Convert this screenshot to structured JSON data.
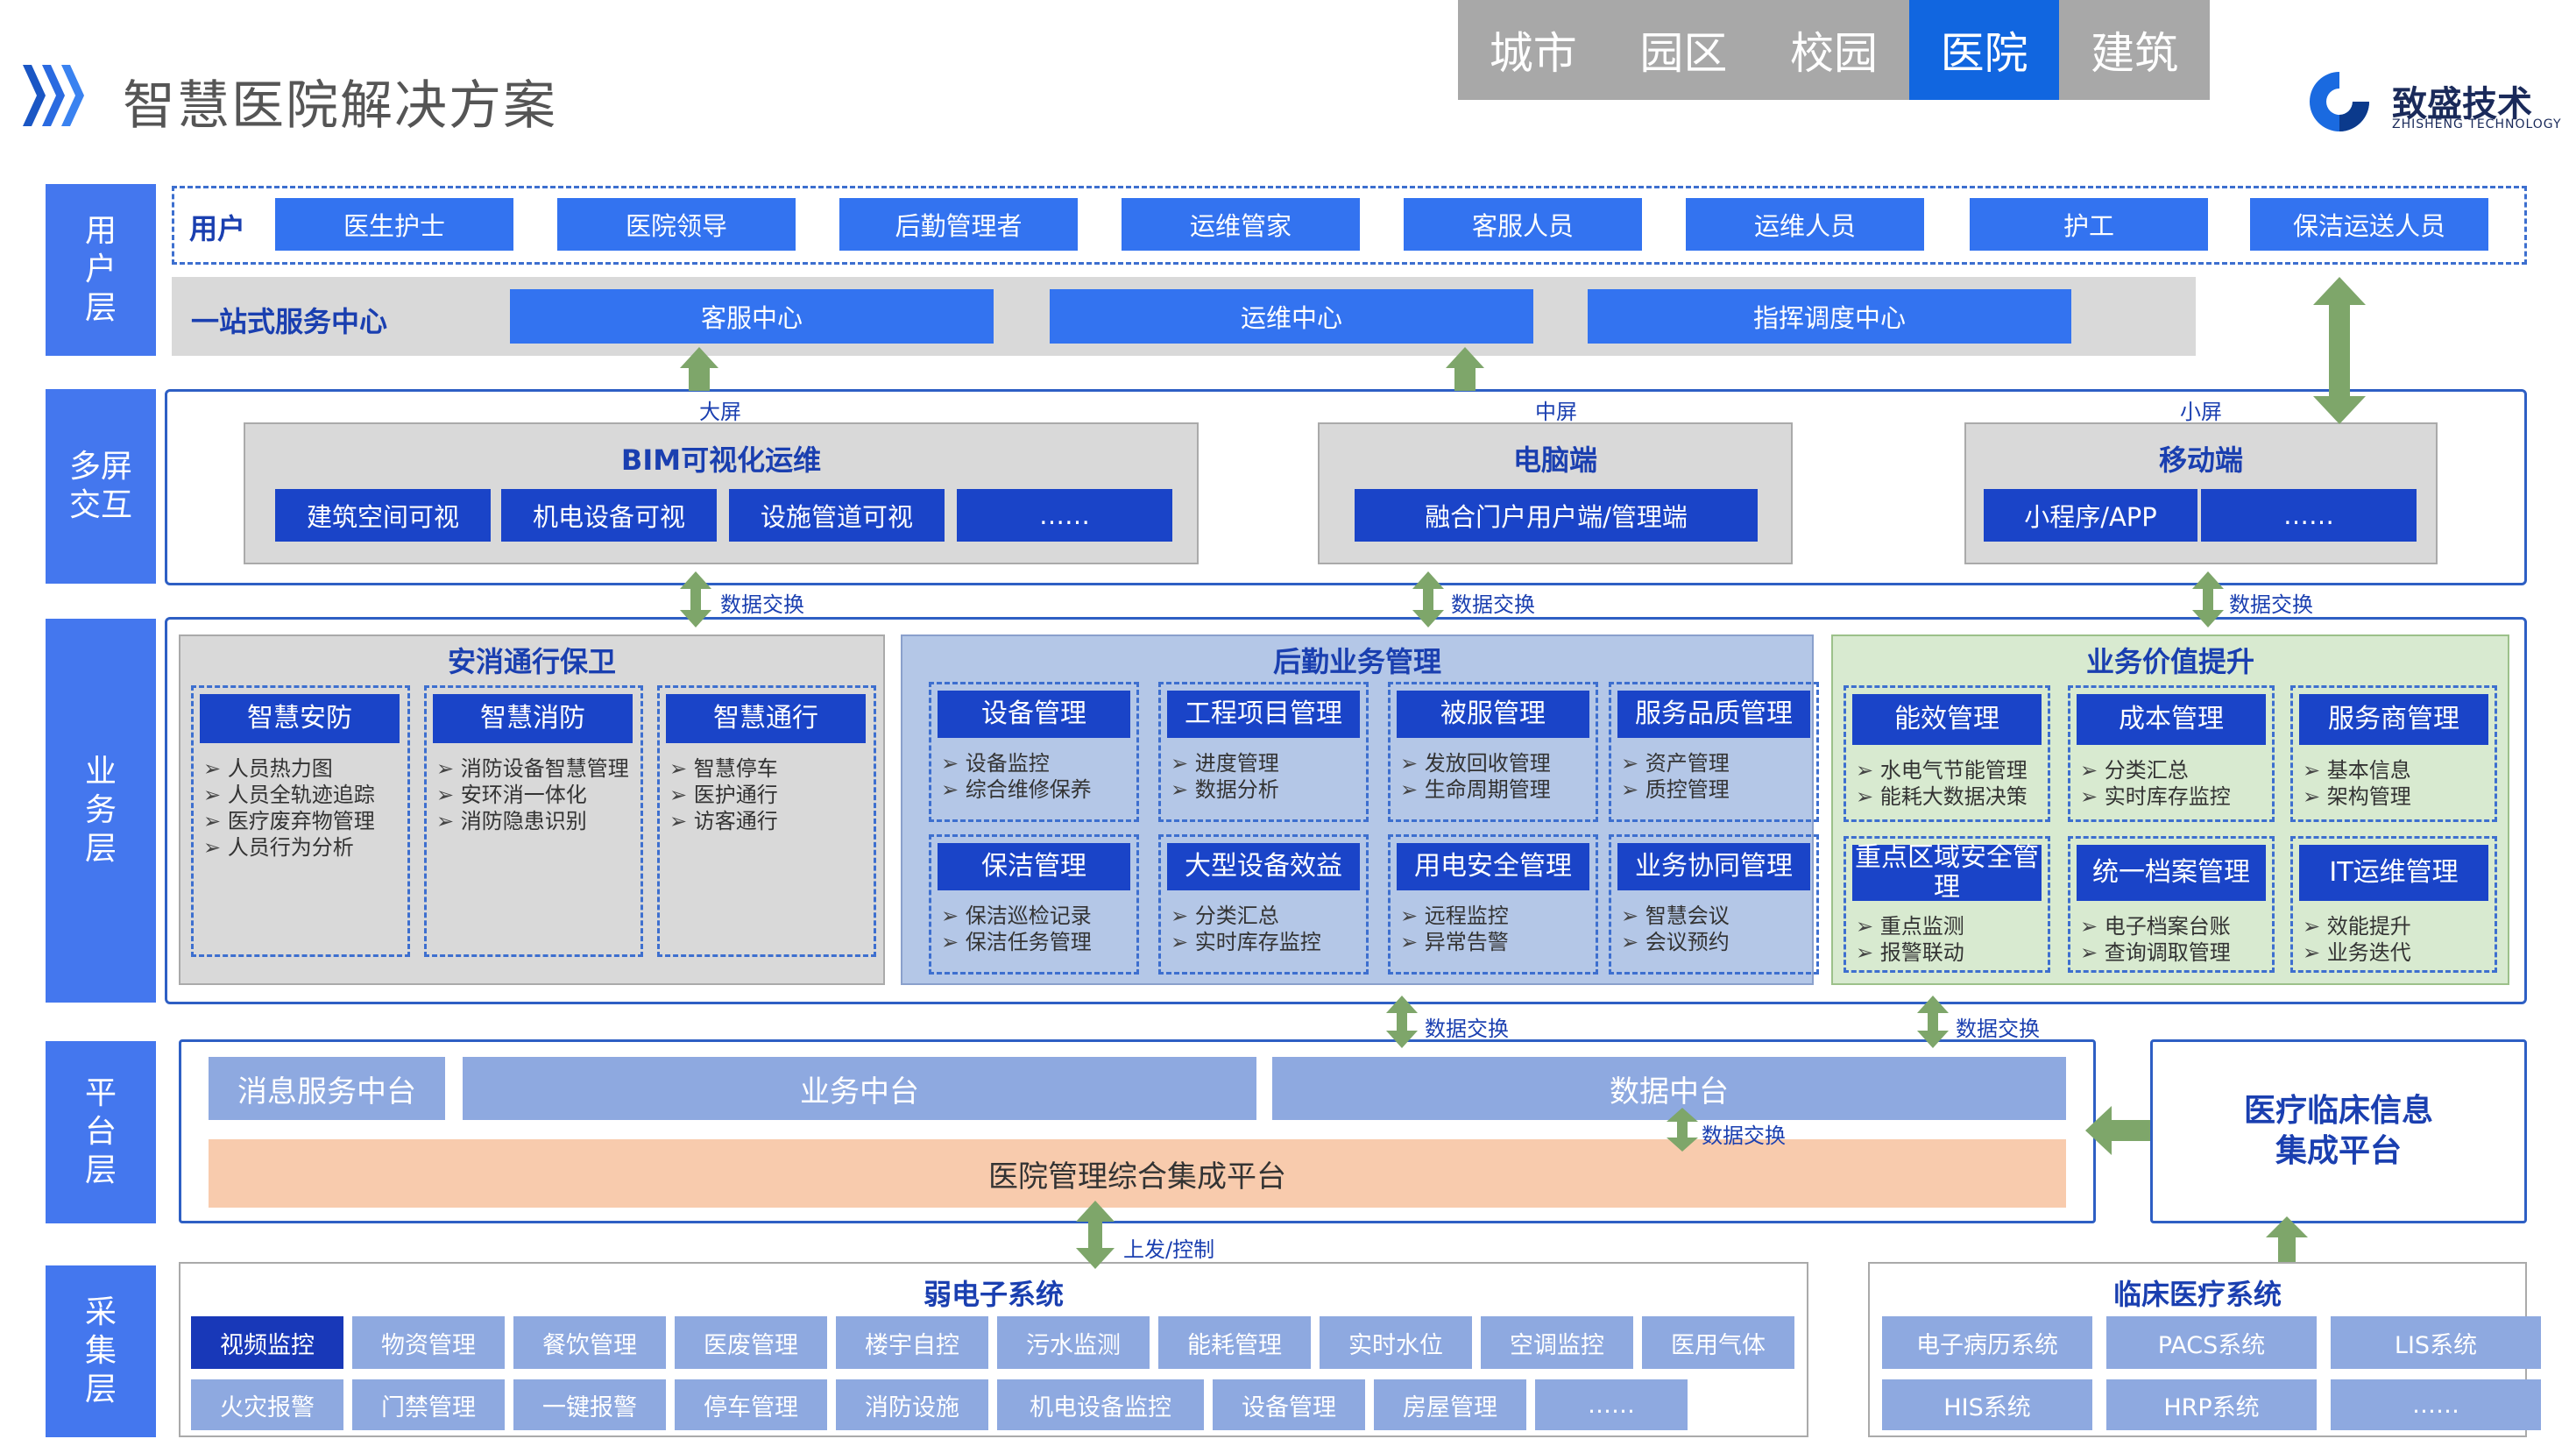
{
  "header": {
    "title": "智慧医院解决方案",
    "tabs": [
      "城市",
      "园区",
      "校园",
      "医院",
      "建筑"
    ],
    "active_tab": "医院",
    "logo_name": "致盛技术",
    "logo_sub": "ZHISHENG TECHNOLOGY"
  },
  "layers": {
    "user": "用\n户\n层",
    "multi": "多屏\n交互",
    "business": "业\n务\n层",
    "platform": "平\n台\n层",
    "collect": "采\n集\n层"
  },
  "user_layer": {
    "users_label": "用户",
    "users": [
      "医生护士",
      "医院领导",
      "后勤管理者",
      "运维管家",
      "客服人员",
      "运维人员",
      "护工",
      "保洁运送人员"
    ],
    "service_label": "一站式服务中心",
    "centers": [
      "客服中心",
      "运维中心",
      "指挥调度中心"
    ]
  },
  "multi_screen": {
    "big_label": "大屏",
    "mid_label": "中屏",
    "small_label": "小屏",
    "bim_title": "BIM可视化运维",
    "bim_items": [
      "建筑空间可视",
      "机电设备可视",
      "设施管道可视",
      "……"
    ],
    "pc_title": "电脑端",
    "pc_item": "融合门户用户端/管理端",
    "mobile_title": "移动端",
    "mobile_items": [
      "小程序/APP",
      "……"
    ],
    "exchange": "数据交换"
  },
  "business": {
    "security": {
      "title": "安消通行保卫",
      "groups": [
        {
          "name": "智慧安防",
          "items": [
            "人员热力图",
            "人员全轨迹追踪",
            "医疗废弃物管理",
            "人员行为分析"
          ]
        },
        {
          "name": "智慧消防",
          "items": [
            "消防设备智慧管理",
            "安环消一体化",
            "消防隐患识别"
          ]
        },
        {
          "name": "智慧通行",
          "items": [
            "智慧停车",
            "医护通行",
            "访客通行"
          ]
        }
      ]
    },
    "logistics": {
      "title": "后勤业务管理",
      "groups": [
        {
          "name": "设备管理",
          "items": [
            "设备监控",
            "综合维修保养"
          ]
        },
        {
          "name": "工程项目管理",
          "items": [
            "进度管理",
            "数据分析"
          ]
        },
        {
          "name": "被服管理",
          "items": [
            "发放回收管理",
            "生命周期管理"
          ]
        },
        {
          "name": "服务品质管理",
          "items": [
            "资产管理",
            "质控管理"
          ]
        },
        {
          "name": "保洁管理",
          "items": [
            "保洁巡检记录",
            "保洁任务管理"
          ]
        },
        {
          "name": "大型设备效益",
          "items": [
            "分类汇总",
            "实时库存监控"
          ]
        },
        {
          "name": "用电安全管理",
          "items": [
            "远程监控",
            "异常告警"
          ]
        },
        {
          "name": "业务协同管理",
          "items": [
            "智慧会议",
            "会议预约"
          ]
        }
      ]
    },
    "value": {
      "title": "业务价值提升",
      "groups": [
        {
          "name": "能效管理",
          "items": [
            "水电气节能管理",
            "能耗大数据决策"
          ]
        },
        {
          "name": "成本管理",
          "items": [
            "分类汇总",
            "实时库存监控"
          ]
        },
        {
          "name": "服务商管理",
          "items": [
            "基本信息",
            "架构管理"
          ]
        },
        {
          "name": "重点区域安全管理",
          "items": [
            "重点监测",
            "报警联动"
          ]
        },
        {
          "name": "统一档案管理",
          "items": [
            "电子档案台账",
            "查询调取管理"
          ]
        },
        {
          "name": "IT运维管理",
          "items": [
            "效能提升",
            "业务迭代"
          ]
        }
      ]
    }
  },
  "platform": {
    "msg": "消息服务中台",
    "biz": "业务中台",
    "data": "数据中台",
    "integration": "医院管理综合集成平台",
    "exchange": "数据交换",
    "clinical_info": "医疗临床信息\n集成平台",
    "up_down": "上发/控制"
  },
  "collect": {
    "weak_title": "弱电子系统",
    "weak_row1": [
      "视频监控",
      "物资管理",
      "餐饮管理",
      "医废管理",
      "楼宇自控",
      "污水监测",
      "能耗管理",
      "实时水位",
      "空调监控",
      "医用气体"
    ],
    "weak_row2": [
      "火灾报警",
      "门禁管理",
      "一键报警",
      "停车管理",
      "消防设施",
      "机电设备监控",
      "设备管理",
      "房屋管理",
      "……"
    ],
    "clinical_title": "临床医疗系统",
    "clinical_row1": [
      "电子病历系统",
      "PACS系统",
      "LIS系统"
    ],
    "clinical_row2": [
      "HIS系统",
      "HRP系统",
      "……"
    ]
  },
  "colors": {
    "accent": "#1166e0",
    "layer_bg": "#4477ee",
    "button_blue": "#3373f0",
    "arrow_green": "#7ea66a",
    "logistics_bg": "#b4c7e7",
    "value_bg": "#d8ead0",
    "integration_bg": "#f8cbad"
  }
}
